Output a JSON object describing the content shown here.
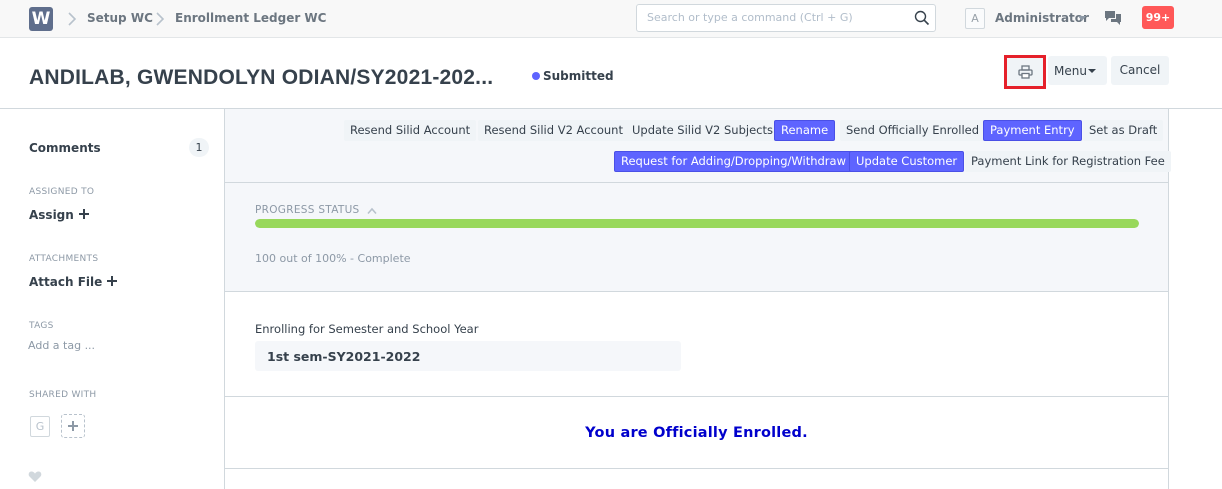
{
  "navbar": {
    "logo_text": "W",
    "breadcrumbs": [
      "Setup WC",
      "Enrollment Ledger WC"
    ],
    "search_placeholder": "Search or type a command (Ctrl + G)",
    "avatar_initial": "A",
    "user_name": "Administrator",
    "notifications": "99+",
    "icons": [
      "chevron-right-icon",
      "search-icon",
      "chat-icon",
      "caret-down-icon"
    ]
  },
  "page": {
    "title": "ANDILAB, GWENDOLYN ODIAN/SY2021-202...",
    "status": "Submitted",
    "menu_label": "Menu",
    "cancel_label": "Cancel"
  },
  "sidebar": {
    "comments_label": "Comments",
    "comments_count": "1",
    "assigned_to_label": "ASSIGNED TO",
    "assign_link": "Assign",
    "attachments_label": "ATTACHMENTS",
    "attach_link": "Attach File",
    "tags_label": "TAGS",
    "tag_placeholder": "Add a tag ...",
    "shared_with_label": "SHARED WITH",
    "shared_initial": "G"
  },
  "actions": [
    {
      "label": "Resend Silid Account",
      "primary": false
    },
    {
      "label": "Resend Silid V2 Account",
      "primary": false
    },
    {
      "label": "Update Silid V2 Subjects",
      "primary": false
    },
    {
      "label": "Rename",
      "primary": true
    },
    {
      "label": "Send Officially Enrolled",
      "primary": false
    },
    {
      "label": "Payment Entry",
      "primary": true
    },
    {
      "label": "Set as Draft",
      "primary": false
    },
    {
      "label": "Request for Adding/Dropping/Withdraw",
      "primary": true
    },
    {
      "label": "Update Customer",
      "primary": true
    },
    {
      "label": "Payment Link for Registration Fee",
      "primary": false
    }
  ],
  "progress": {
    "heading": "PROGRESS STATUS",
    "percent": 100,
    "text": "100 out of 100% - Complete",
    "color": "#98d85b"
  },
  "form": {
    "semester_label": "Enrolling for Semester and School Year",
    "semester_value": "1st sem-SY2021-2022",
    "enrolled_message": "You are Officially Enrolled."
  },
  "colors": {
    "accent": "#5e64ff",
    "alert": "#ff5858",
    "highlight_border": "#e5202a",
    "enrolled_text": "#0000cc"
  }
}
